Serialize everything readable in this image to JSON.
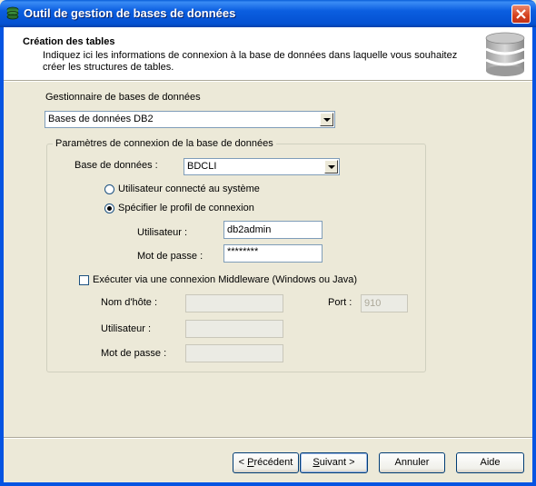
{
  "window": {
    "title": "Outil de gestion de bases de données"
  },
  "header": {
    "title": "Création des tables",
    "description": "Indiquez ici les informations de connexion à la base de données dans laquelle vous souhaitez créer les structures de tables."
  },
  "form": {
    "db_manager_label": "Gestionnaire de bases de données",
    "db_manager_value": "Bases de données DB2",
    "group_label": "Paramètres de connexion de la base de données",
    "database_label": "Base de données :",
    "database_value": "BDCLI",
    "radio_system_user": "Utilisateur connecté au système",
    "radio_profile": "Spécifier le profil de connexion",
    "user_label": "Utilisateur :",
    "user_value": "db2admin",
    "password_label": "Mot de passe :",
    "password_value": "********",
    "middleware_checkbox": "Exécuter via une connexion Middleware (Windows ou Java)",
    "host_label": "Nom d'hôte :",
    "port_label": "Port :",
    "port_value": "910",
    "mw_user_label": "Utilisateur :",
    "mw_password_label": "Mot de passe :"
  },
  "buttons": {
    "previous_prefix": "< ",
    "previous_hotkey": "P",
    "previous_rest": "récédent",
    "next_hotkey": "S",
    "next_rest": "uivant >",
    "cancel": "Annuler",
    "help": "Aide"
  }
}
